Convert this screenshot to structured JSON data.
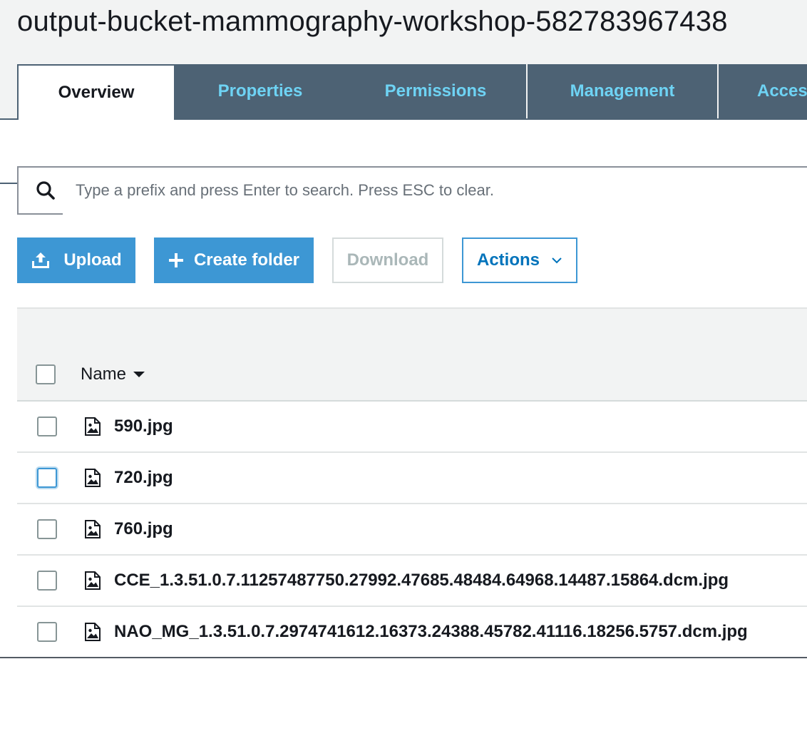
{
  "header": {
    "bucket_name": "output-bucket-mammography-workshop-582783967438"
  },
  "tabs": [
    {
      "label": "Overview",
      "active": true
    },
    {
      "label": "Properties",
      "active": false
    },
    {
      "label": "Permissions",
      "active": false
    },
    {
      "label": "Management",
      "active": false
    },
    {
      "label": "Acces",
      "active": false
    }
  ],
  "search": {
    "placeholder": "Type a prefix and press Enter to search. Press ESC to clear.",
    "value": ""
  },
  "toolbar": {
    "upload_label": "Upload",
    "create_folder_label": "Create folder",
    "download_label": "Download",
    "actions_label": "Actions"
  },
  "table": {
    "name_header": "Name",
    "rows": [
      {
        "name": "590.jpg"
      },
      {
        "name": "720.jpg"
      },
      {
        "name": "760.jpg"
      },
      {
        "name": "CCE_1.3.51.0.7.11257487750.27992.47685.48484.64968.14487.15864.dcm.jpg"
      },
      {
        "name": "NAO_MG_1.3.51.0.7.2974741612.16373.24388.45782.41116.18256.5757.dcm.jpg"
      }
    ]
  },
  "colors": {
    "tab_bg": "#4d6274",
    "tab_text": "#6ed3f4",
    "primary_button": "#3d97d4",
    "header_band": "#f2f3f3"
  },
  "icons": {
    "search": "search-icon",
    "upload": "upload-icon",
    "create_folder": "plus-icon",
    "actions": "chevron-down-icon",
    "sort": "sort-down-icon",
    "file": "image-file-icon"
  }
}
